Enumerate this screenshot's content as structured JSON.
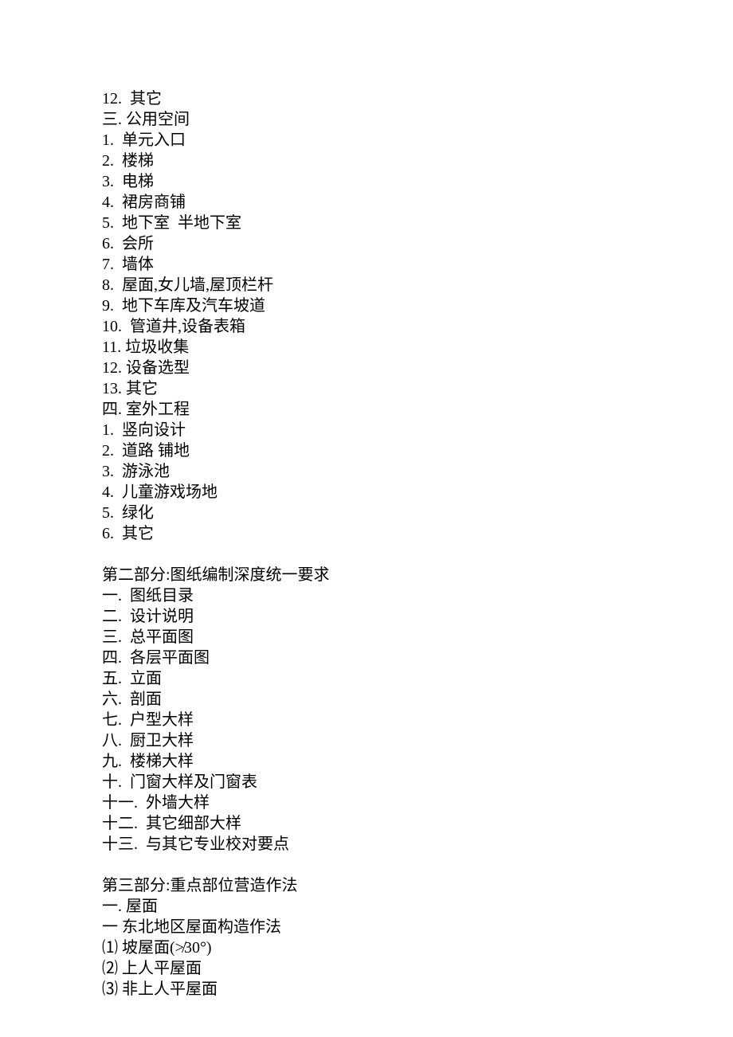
{
  "section1": {
    "items": [
      "12.  其它",
      "三. 公用空间",
      "1.  单元入口",
      "2.  楼梯",
      "3.  电梯",
      "4.  裙房商铺",
      "5.  地下室  半地下室",
      "6.  会所",
      "7.  墙体",
      "8.  屋面,女儿墙,屋顶栏杆",
      "9.  地下车库及汽车坡道",
      "10.  管道井,设备表箱",
      "11. 垃圾收集",
      "12. 设备选型",
      "13. 其它",
      "四. 室外工程",
      "1.  竖向设计",
      "2.  道路 铺地",
      "3.  游泳池",
      "4.  儿童游戏场地",
      "5.  绿化",
      "6.  其它"
    ]
  },
  "section2": {
    "title": "第二部分:图纸编制深度统一要求",
    "items": [
      "一.  图纸目录",
      "二.  设计说明",
      "三.  总平面图",
      "四.  各层平面图",
      "五.  立面",
      "六.  剖面",
      "七.  户型大样",
      "八.  厨卫大样",
      "九.  楼梯大样",
      "十.  门窗大样及门窗表",
      "十一.  外墙大样",
      "十二.  其它细部大样",
      "十三.  与其它专业校对要点"
    ]
  },
  "section3": {
    "title": "第三部分:重点部位营造作法",
    "items": [
      "一. 屋面",
      "一 东北地区屋面构造作法",
      "⑴ 坡屋面(≯30°)",
      "⑵ 上人平屋面",
      "⑶ 非上人平屋面"
    ]
  }
}
